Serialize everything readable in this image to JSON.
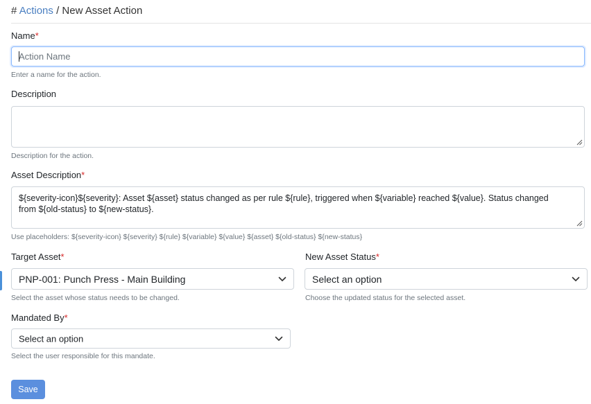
{
  "breadcrumb": {
    "hash": "#",
    "parent": "Actions",
    "separator": "/",
    "current": "New Asset Action"
  },
  "form": {
    "name": {
      "label": "Name",
      "required_mark": "*",
      "placeholder": "Action Name",
      "value": "",
      "help": "Enter a name for the action."
    },
    "description": {
      "label": "Description",
      "value": "",
      "help": "Description for the action."
    },
    "asset_description": {
      "label": "Asset Description",
      "required_mark": "*",
      "value": "${severity-icon}${severity}: Asset ${asset} status changed as per rule ${rule}, triggered when ${variable} reached ${value}. Status changed from ${old-status} to ${new-status}.",
      "help": "Use placeholders: ${severity-icon} ${severity} ${rule} ${variable} ${value} ${asset} ${old-status} ${new-status}"
    },
    "target_asset": {
      "label": "Target Asset",
      "required_mark": "*",
      "selected": "PNP-001: Punch Press - Main Building",
      "help": "Select the asset whose status needs to be changed."
    },
    "new_asset_status": {
      "label": "New Asset Status",
      "required_mark": "*",
      "selected": "Select an option",
      "help": "Choose the updated status for the selected asset."
    },
    "mandated_by": {
      "label": "Mandated By",
      "required_mark": "*",
      "selected": "Select an option",
      "help": "Select the user responsible for this mandate."
    },
    "save_label": "Save"
  },
  "icons": {
    "chevron": "chevron-down-icon",
    "resize": "resize-handle-icon"
  },
  "colors": {
    "link": "#4a7fc1",
    "required": "#d62828",
    "primary_button": "#5b8fde",
    "focus_border": "#86b7fe"
  }
}
